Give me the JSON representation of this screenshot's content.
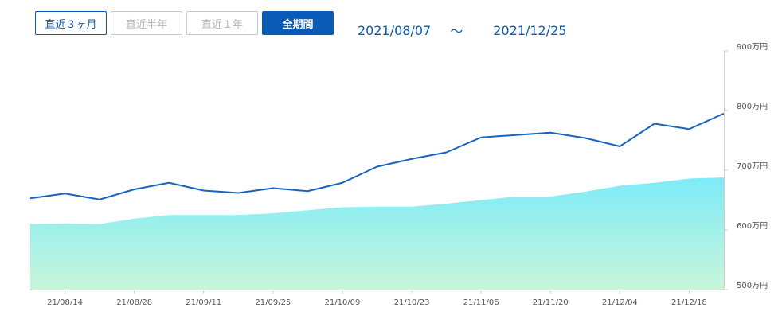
{
  "range_buttons": [
    {
      "label": "直近３ヶ月",
      "state": "normal"
    },
    {
      "label": "直近半年",
      "state": "disabled"
    },
    {
      "label": "直近１年",
      "state": "disabled"
    },
    {
      "label": "全期間",
      "state": "active"
    }
  ],
  "date_range": {
    "start": "2021/08/07",
    "separator": "～",
    "end": "2021/12/25"
  },
  "colors": {
    "accent": "#0a5bb5",
    "line": "#1565c0",
    "area_top": "#7eebf8",
    "area_bottom": "#c8f5d9"
  },
  "chart_data": {
    "type": "line",
    "x": [
      "21/08/07",
      "21/08/14",
      "21/08/21",
      "21/08/28",
      "21/09/04",
      "21/09/11",
      "21/09/18",
      "21/09/25",
      "21/10/02",
      "21/10/09",
      "21/10/16",
      "21/10/23",
      "21/10/30",
      "21/11/06",
      "21/11/13",
      "21/11/20",
      "21/11/27",
      "21/12/04",
      "21/12/11",
      "21/12/18",
      "21/12/25"
    ],
    "series": [
      {
        "style": "line",
        "values": [
          653,
          661,
          651,
          668,
          679,
          666,
          662,
          670,
          665,
          679,
          706,
          719,
          730,
          755,
          759,
          763,
          754,
          740,
          778,
          769,
          795
        ]
      },
      {
        "style": "area",
        "values": [
          610,
          611,
          610,
          619,
          625,
          625,
          625,
          628,
          633,
          638,
          639,
          639,
          644,
          650,
          656,
          656,
          664,
          674,
          679,
          686,
          688
        ]
      }
    ],
    "x_tick_labels": [
      "21/08/14",
      "21/08/28",
      "21/09/11",
      "21/09/25",
      "21/10/09",
      "21/10/23",
      "21/11/06",
      "21/11/20",
      "21/12/04",
      "21/12/18"
    ],
    "y_tick_labels": [
      "900万円",
      "800万円",
      "700万円",
      "600万円",
      "500万円"
    ],
    "y_ticks": [
      900,
      800,
      700,
      600,
      500
    ],
    "ylim": [
      500,
      900
    ],
    "grid": false
  }
}
